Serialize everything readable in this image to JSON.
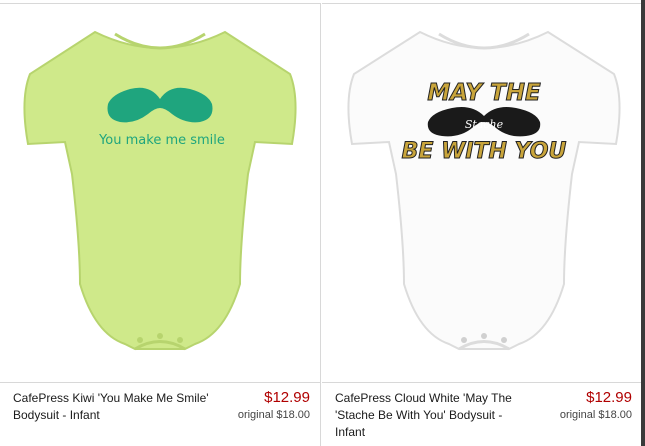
{
  "products": [
    {
      "title": "CafePress Kiwi 'You Make Me Smile' Bodysuit - Infant",
      "price": "$12.99",
      "original": "original $18.00",
      "print_text": "You make me smile",
      "garment_color": "#cfe98a",
      "print_color": "#1fa57e"
    },
    {
      "title": "CafePress Cloud White 'May The 'Stache Be With You' Bodysuit - Infant",
      "price": "$12.99",
      "original": "original $18.00",
      "print_line1": "MAY THE",
      "print_mid": "Stache",
      "print_line2": "BE WITH YOU",
      "garment_color": "#fbfbfb",
      "print_color": "#c9a53b"
    }
  ]
}
